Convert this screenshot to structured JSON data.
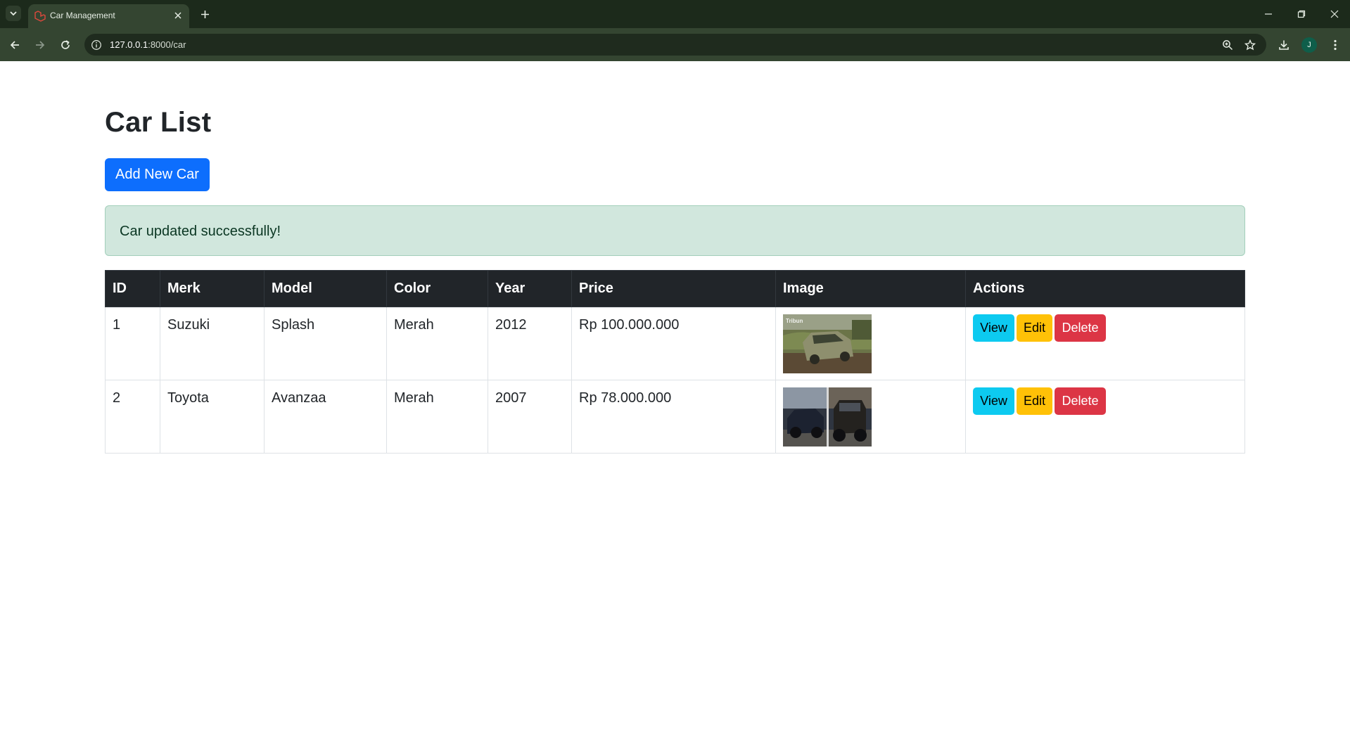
{
  "browser": {
    "tab_title": "Car Management",
    "url_host": "127.0.0.1",
    "url_rest": ":8000/car",
    "profile_initial": "J"
  },
  "page": {
    "title": "Car List",
    "add_button": "Add New Car",
    "alert": "Car updated successfully!"
  },
  "table": {
    "headers": [
      "ID",
      "Merk",
      "Model",
      "Color",
      "Year",
      "Price",
      "Image",
      "Actions"
    ],
    "rows": [
      {
        "id": "1",
        "merk": "Suzuki",
        "model": "Splash",
        "color": "Merah",
        "year": "2012",
        "price": "Rp 100.000.000"
      },
      {
        "id": "2",
        "merk": "Toyota",
        "model": "Avanzaa",
        "color": "Merah",
        "year": "2007",
        "price": "Rp 78.000.000"
      }
    ],
    "actions": {
      "view": "View",
      "edit": "Edit",
      "delete": "Delete"
    }
  },
  "colors": {
    "primary": "#0d6efd",
    "info": "#0dcaf0",
    "warning": "#ffc107",
    "danger": "#dc3545",
    "success_bg": "#d1e7dd",
    "table_header": "#212529"
  },
  "icons": [
    "tab-search-icon",
    "laravel-favicon-icon",
    "close-icon",
    "plus-icon",
    "minimize-icon",
    "restore-icon",
    "back-icon",
    "forward-icon",
    "reload-icon",
    "info-icon",
    "zoom-icon",
    "star-icon",
    "download-icon",
    "menu-icon"
  ]
}
